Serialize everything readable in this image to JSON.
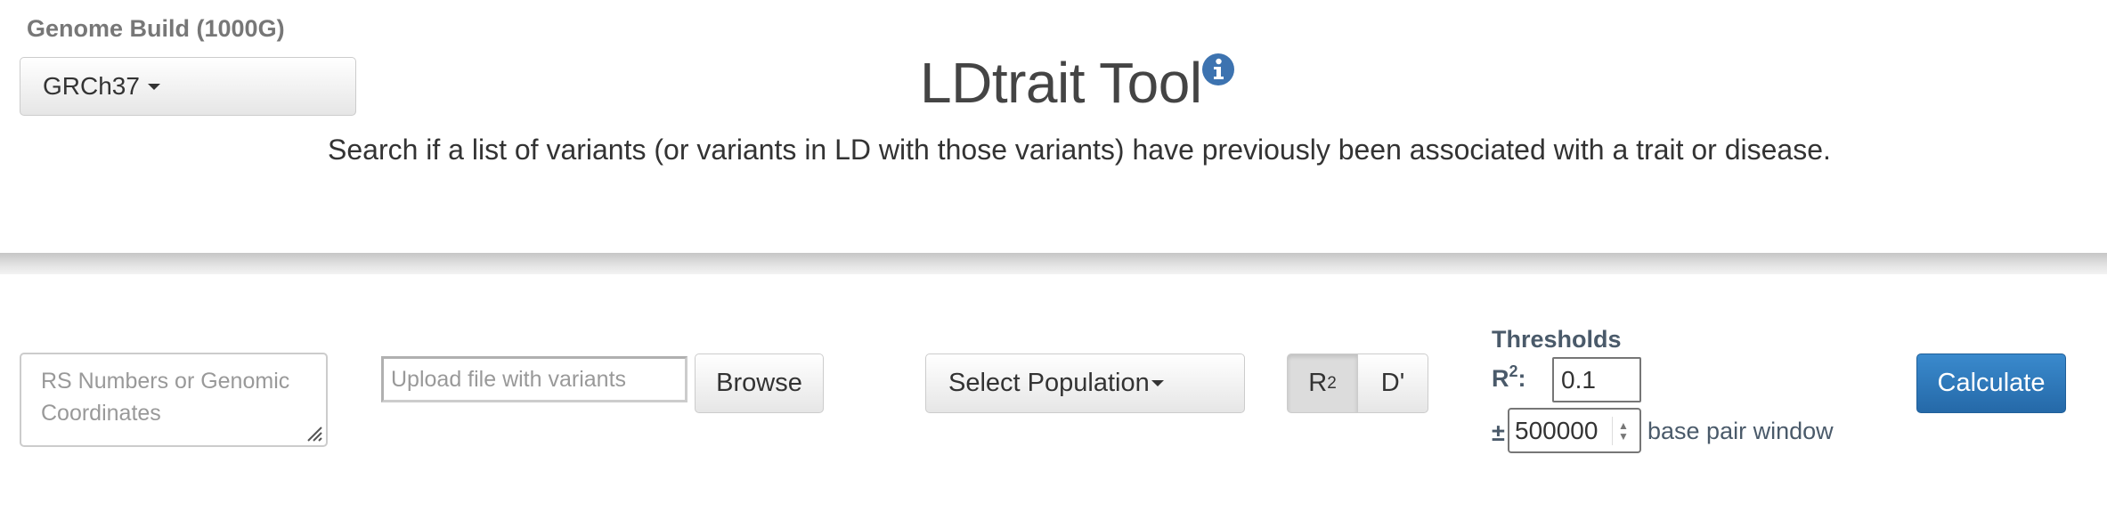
{
  "header": {
    "build_label": "Genome Build (1000G)",
    "build_value": "GRCh37",
    "title": "LDtrait Tool",
    "subtitle": "Search if a list of variants (or variants in LD with those variants) have previously been associated with a trait or disease."
  },
  "form": {
    "rs_placeholder_line1": "RS Numbers or Genomic",
    "rs_placeholder_line2": "Coordinates",
    "upload_placeholder": "Upload file with variants",
    "browse_label": "Browse",
    "population_label": "Select Population",
    "ld_toggle": {
      "r2_label": "R",
      "r2_superscript": "2",
      "d_label": "D'",
      "active": "R2"
    },
    "thresholds": {
      "title": "Thresholds",
      "r2_label": "R",
      "r2_superscript": "2",
      "r2_colon": ":",
      "r2_value": "0.1",
      "window_prefix": "±",
      "window_value": "500000",
      "window_suffix": "base pair window"
    },
    "calculate_label": "Calculate"
  },
  "colors": {
    "primary_button": "#2a73b5",
    "info_icon": "#3d73b0",
    "threshold_text": "#4a5a6a"
  },
  "icons": {
    "info": "info-circle-icon",
    "caret": "caret-down-icon",
    "resize": "resize-grip-icon",
    "spinner": "spinner-arrows-icon"
  }
}
